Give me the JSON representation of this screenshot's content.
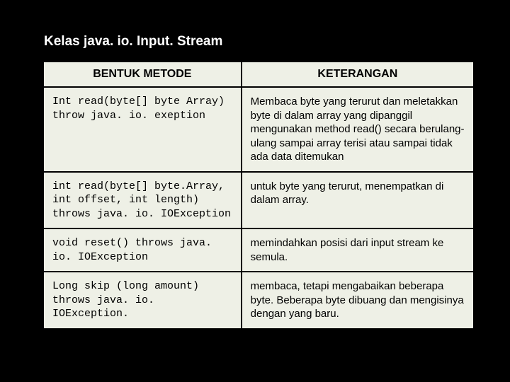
{
  "title": "Kelas java. io. Input. Stream",
  "headers": {
    "col1": "BENTUK METODE",
    "col2": "KETERANGAN"
  },
  "rows": [
    {
      "method": "Int read(byte[] byte Array) throw java. io. exeption",
      "desc": "Membaca byte yang terurut dan meletakkan byte di dalam array yang dipanggil mengunakan method read() secara berulang-ulang sampai array terisi atau sampai tidak ada data ditemukan"
    },
    {
      "method": "int read(byte[] byte.Array, int offset, int length) throws java. io. IOException",
      "desc": "untuk byte yang terurut, menempatkan di dalam array."
    },
    {
      "method": "void reset() throws java. io. IOException",
      "desc": "memindahkan posisi dari input stream ke semula."
    },
    {
      "method": "Long skip (long amount) throws java. io. IOException.",
      "desc": "membaca, tetapi mengabaikan beberapa byte. Beberapa byte dibuang dan mengisinya dengan yang baru."
    }
  ]
}
